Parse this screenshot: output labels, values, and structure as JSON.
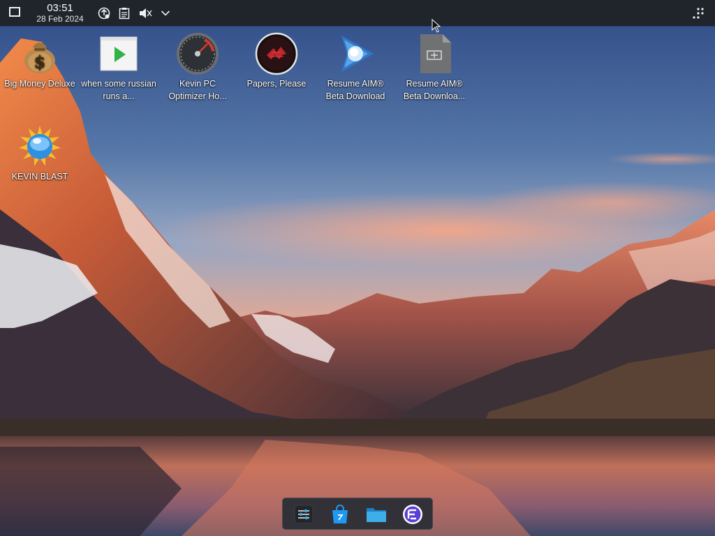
{
  "panel": {
    "clock_time": "03:51",
    "clock_date": "28 Feb 2024",
    "tray_icons": [
      "update-icon",
      "clipboard-icon",
      "volume-muted-icon",
      "chevron-down-icon"
    ],
    "overflow_icon": "panel-config-icon"
  },
  "desktop": {
    "icons": [
      {
        "label": "Big Money Deluxe",
        "icon": "money-bag-icon"
      },
      {
        "label": "when some russian runs a...",
        "icon": "video-play-icon"
      },
      {
        "label": "Kevin PC Optimizer Ho...",
        "icon": "speedometer-icon"
      },
      {
        "label": "Papers, Please",
        "icon": "papers-please-icon"
      },
      {
        "label": "Resume AIM® Beta Download",
        "icon": "aim-icon"
      },
      {
        "label": "Resume AIM® Beta Downloa...",
        "icon": "executable-file-icon"
      },
      {
        "label": "KEVIN BLAST",
        "icon": "kevin-blast-icon"
      }
    ]
  },
  "dock": {
    "items": [
      "system-settings-icon",
      "discover-store-icon",
      "file-manager-icon",
      "app-launcher-icon"
    ]
  },
  "colors": {
    "panel_bg": "#20242b",
    "dock_bg": "#282c34",
    "accent_blue": "#3daee9",
    "launcher_purple": "#5b3fd6"
  }
}
